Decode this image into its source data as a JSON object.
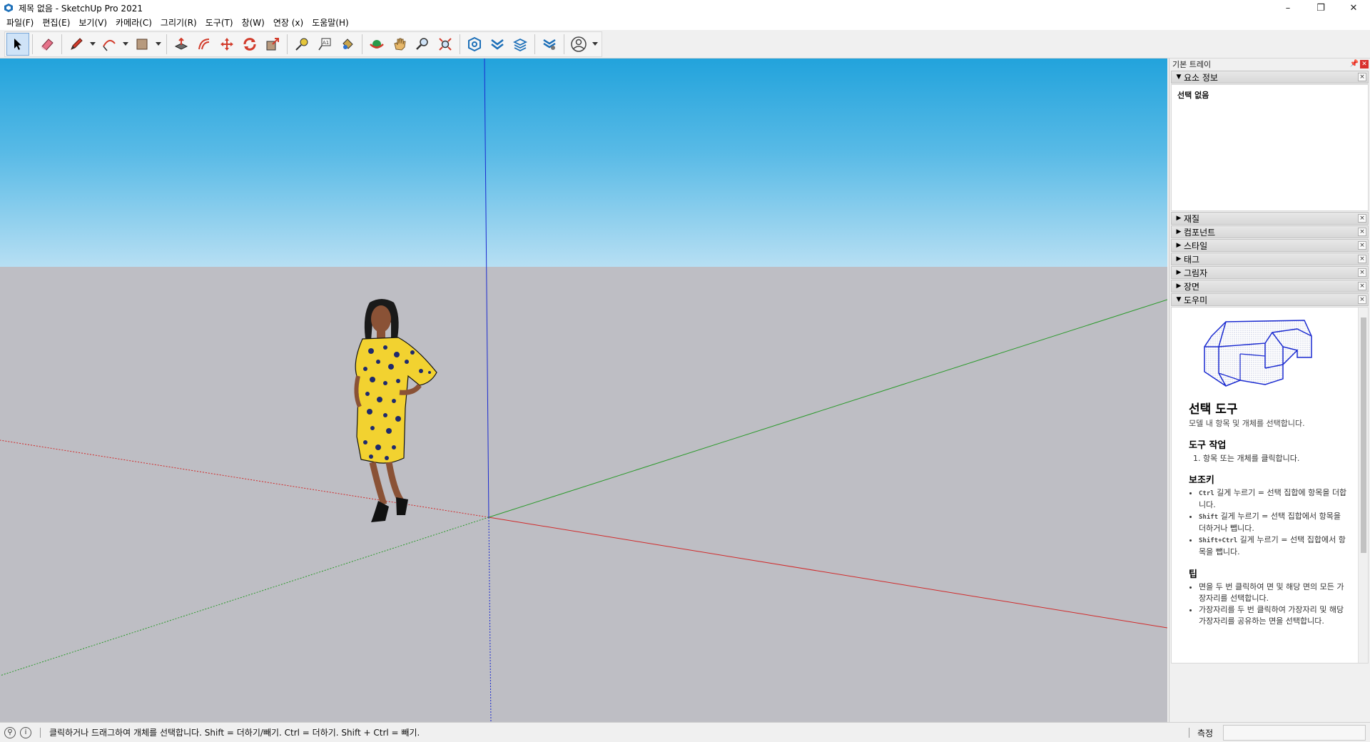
{
  "window": {
    "title": "제목 없음 - SketchUp Pro 2021",
    "controls": [
      "–",
      "❐",
      "✕"
    ]
  },
  "menu": [
    "파일(F)",
    "편집(E)",
    "보기(V)",
    "카메라(C)",
    "그리기(R)",
    "도구(T)",
    "창(W)",
    "연장 (x)",
    "도움말(H)"
  ],
  "toolbar": {
    "tools": [
      {
        "name": "select-tool",
        "icon": "arrow-icon",
        "active": true
      },
      {
        "name": "eraser-tool",
        "icon": "eraser-icon"
      },
      {
        "name": "line-tool",
        "icon": "pencil-icon"
      },
      {
        "name": "arc-tool",
        "icon": "arc-icon"
      },
      {
        "name": "rectangle-tool",
        "icon": "rectangle-icon"
      },
      {
        "name": "push-pull-tool",
        "icon": "push-pull-icon"
      },
      {
        "name": "offset-tool",
        "icon": "offset-icon"
      },
      {
        "name": "move-tool",
        "icon": "move-icon"
      },
      {
        "name": "rotate-tool",
        "icon": "rotate-icon"
      },
      {
        "name": "scale-tool",
        "icon": "scale-icon"
      },
      {
        "name": "tape-measure-tool",
        "icon": "tape-measure-icon"
      },
      {
        "name": "text-tool",
        "icon": "text-icon"
      },
      {
        "name": "paint-bucket-tool",
        "icon": "paint-bucket-icon"
      },
      {
        "name": "orbit-tool",
        "icon": "orbit-icon"
      },
      {
        "name": "pan-tool",
        "icon": "hand-icon"
      },
      {
        "name": "zoom-tool",
        "icon": "zoom-icon"
      },
      {
        "name": "zoom-extents-tool",
        "icon": "zoom-extents-icon"
      },
      {
        "name": "3d-warehouse-button",
        "icon": "warehouse-icon"
      },
      {
        "name": "extension-warehouse-button",
        "icon": "extension-warehouse-icon"
      },
      {
        "name": "layout-button",
        "icon": "layout-icon"
      },
      {
        "name": "extension-manager-button",
        "icon": "extension-manager-icon"
      },
      {
        "name": "account-button",
        "icon": "user-icon"
      }
    ]
  },
  "tray": {
    "title": "기본 트레이",
    "entity_info": {
      "header": "요소 정보",
      "body": "선택 없음"
    },
    "panels": [
      "재질",
      "컴포넌트",
      "스타일",
      "태그",
      "그림자",
      "장면"
    ],
    "instructor": {
      "header": "도우미",
      "title": "선택 도구",
      "description": "모델 내 항목 및 개체를 선택합니다.",
      "tool_ops_heading": "도구 작업",
      "tool_ops_step": "1. 항목 또는 개체를 클릭합니다.",
      "modifier_heading": "보조키",
      "modifiers": [
        {
          "key": "Ctrl",
          "text": " 길게 누르기 = 선택 집합에 항목을 더합니다."
        },
        {
          "key": "Shift",
          "text": " 길게 누르기 = 선택 집합에서 항목을 더하거나 뺍니다."
        },
        {
          "key": "Shift+Ctrl",
          "text": " 길게 누르기 = 선택 집합에서 항목을 뺍니다."
        }
      ],
      "tips_heading": "팁",
      "tips": [
        "면을 두 번 클릭하여 면 및 해당 면의 모든 가장자리를 선택합니다.",
        "가장자리를 두 번 클릭하여 가장자리 및 해당 가장자리를 공유하는 면을 선택합니다."
      ]
    }
  },
  "status": {
    "text": "클릭하거나 드래그하여 개체를 선택합니다. Shift = 더하기/빼기. Ctrl = 더하기. Shift + Ctrl = 빼기.",
    "measure_label": "측정",
    "measure_value": ""
  },
  "colors": {
    "sky_top": "#22a3dc",
    "ground": "#bebec4",
    "axis_red": "#d12a2a",
    "axis_green": "#2a9a2a",
    "axis_blue": "#1a2ad0"
  }
}
